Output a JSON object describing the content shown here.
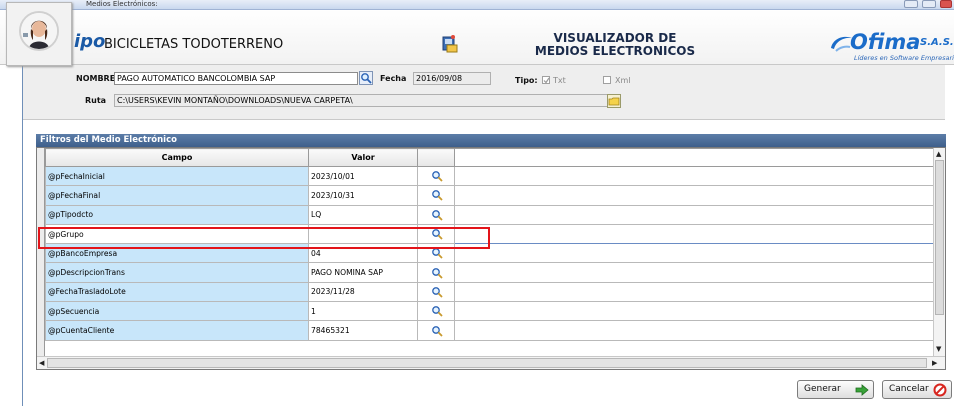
{
  "window": {
    "title": "Medios Electrónicos:"
  },
  "header": {
    "logo_text": "ipo",
    "company_name": "BICICLETAS TODOTERRENO",
    "app_title_line1": "VISUALIZADOR DE",
    "app_title_line2": "MEDIOS ELECTRONICOS",
    "brand": "Ofima",
    "brand_suffix": "S.A.S.",
    "brand_tagline": "Líderes en Software Empresarial"
  },
  "form": {
    "nombre_label": "NOMBRE",
    "nombre_value": "PAGO AUTOMATICO BANCOLOMBIA SAP",
    "fecha_label": "Fecha",
    "fecha_value": "2016/09/08",
    "tipo_label": "Tipo:",
    "tipo_txt_label": "Txt",
    "tipo_xml_label": "Xml",
    "ruta_label": "Ruta",
    "ruta_value": "C:\\USERS\\KEVIN MONTAÑO\\DOWNLOADS\\NUEVA CARPETA\\"
  },
  "filters": {
    "section_title": "Filtros del  Medio Electrónico",
    "columns": [
      "Campo",
      "Valor"
    ],
    "rows": [
      {
        "campo": "@pFechaInicial",
        "valor": "2023/10/01"
      },
      {
        "campo": "@pFechaFinal",
        "valor": "2023/10/31"
      },
      {
        "campo": "@pTipodcto",
        "valor": "LQ"
      },
      {
        "campo": "@pGrupo",
        "valor": ""
      },
      {
        "campo": "@pBancoEmpresa",
        "valor": "04"
      },
      {
        "campo": "@pDescripcionTrans",
        "valor": "PAGO NOMINA SAP"
      },
      {
        "campo": "@FechaTrasladoLote",
        "valor": "2023/11/28"
      },
      {
        "campo": "@pSecuencia",
        "valor": "1"
      },
      {
        "campo": "@pCuentaCliente",
        "valor": "78465321"
      }
    ]
  },
  "actions": {
    "generar_label": "Generar",
    "cancelar_label": "Cancelar"
  },
  "colors": {
    "accent_blue": "#1b6cc9",
    "section_bar": "#4a6b96",
    "campo_cell": "#c8e6fa",
    "highlight": "#e3141a"
  }
}
